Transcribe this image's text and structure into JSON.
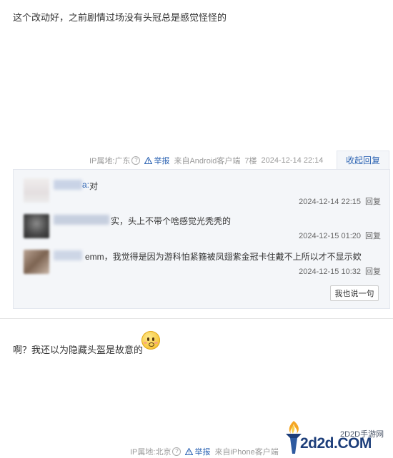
{
  "post1": {
    "text": "这个改动好，之前剧情过场没有头冠总是感觉怪怪的",
    "ip_label": "IP属地:广东",
    "help_icon": "?",
    "report_label": "举报",
    "source": "来自Android客户端",
    "floor": "7楼",
    "timestamp": "2024-12-14 22:14",
    "collapse_label": "收起回复"
  },
  "replies": [
    {
      "text": "对",
      "prefix": "a:",
      "time": "2024-12-14 22:15",
      "reply_label": "回复"
    },
    {
      "text": "实，头上不带个啥感觉光秃秃的",
      "time": "2024-12-15 01:20",
      "reply_label": "回复"
    },
    {
      "text": "emm，我觉得是因为游科怕紧箍被凤翅紫金冠卡住戴不上所以才不显示欸",
      "time": "2024-12-15 10:32",
      "reply_label": "回复"
    }
  ],
  "say_button": "我也说一句",
  "post2": {
    "text": "啊？我还以为隐藏头盔是故意的",
    "ip_label": "IP属地:北京",
    "help_icon": "?",
    "report_label": "举报",
    "source": "来自iPhone客户端"
  },
  "watermark": {
    "top": "2D2D手游网",
    "main": "2d2d.COM"
  },
  "colors": {
    "link": "#2d64b3",
    "reply_bg": "#f4f6f9",
    "meta_text": "#999999"
  },
  "icons": [
    "help-icon",
    "warning-icon",
    "emoji-icon",
    "torch-logo-icon"
  ]
}
